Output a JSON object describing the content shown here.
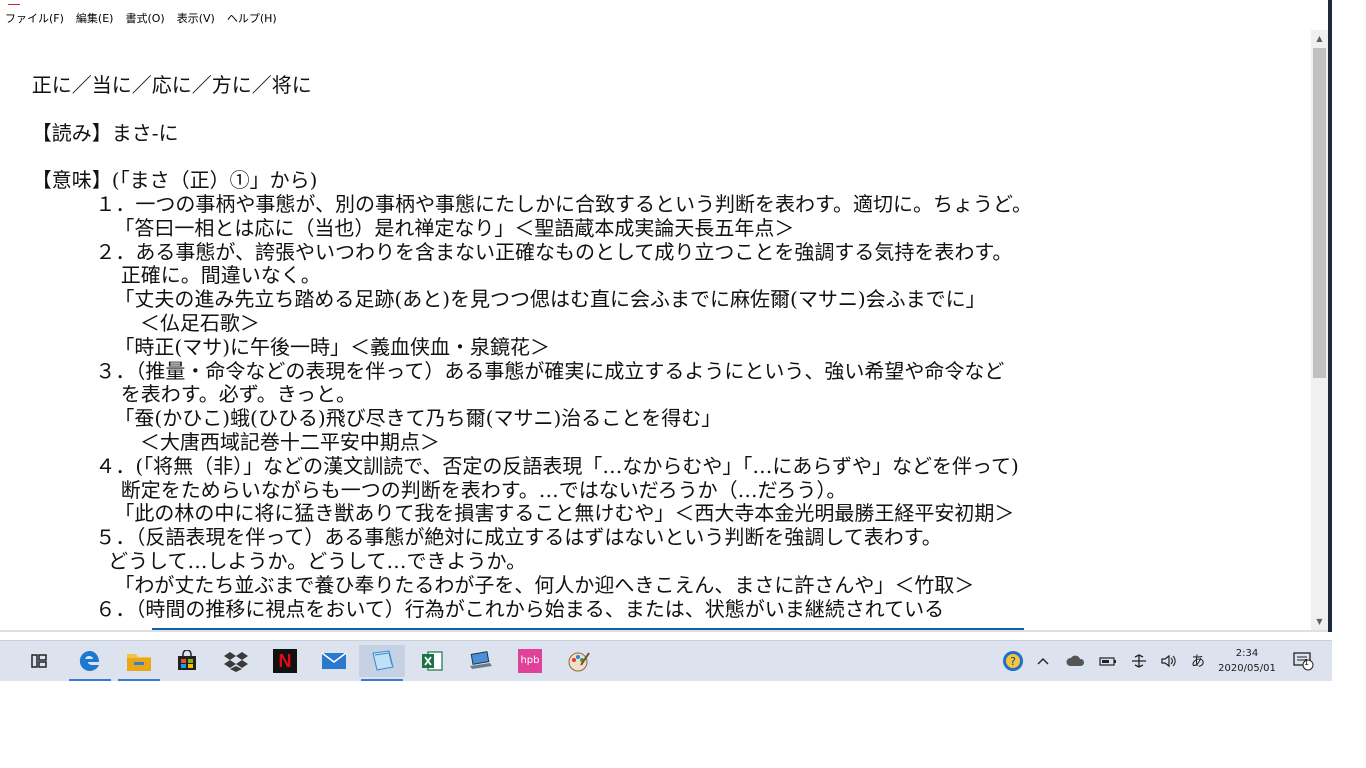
{
  "window": {
    "menu": [
      "ファイル(F)",
      "編集(E)",
      "書式(O)",
      "表示(V)",
      "ヘルプ(H)"
    ]
  },
  "document": {
    "lines": [
      "     正に／当に／応に／方に／将に",
      "",
      "     【読み】まさ‐に",
      "",
      "     【意味】(「まさ（正）①」から)",
      "               １．一つの事柄や事態が、別の事柄や事態にたしかに合致するという判断を表わす。適切に。ちょうど。",
      "                  「答曰一相とは応に（当也）是れ禅定なり」＜聖語蔵本成実論天長五年点＞",
      "               ２．ある事態が、誇張やいつわりを含まない正確なものとして成り立つことを強調する気持を表わす。",
      "                   正確に。間違いなく。",
      "                  「丈夫の進み先立ち踏める足跡(あと)を見つつ偲はむ直に会ふまでに麻佐爾(マサニ)会ふまでに」",
      "                      ＜仏足石歌＞",
      "                  「時正(マサ)に午後一時」＜義血侠血・泉鏡花＞",
      "               ３．（推量・命令などの表現を伴って）ある事態が確実に成立するようにという、強い希望や命令など",
      "                   を表わす。必ず。きっと。",
      "                  「蚕(かひこ)蛾(ひひる)飛び尽きて乃ち爾(マサニ)治ることを得む」",
      "                      ＜大唐西域記巻十二平安中期点＞",
      "               ４．(「将無（非）」などの漢文訓読で、否定の反語表現「…なからむや」「…にあらずや」などを伴って)",
      "                   断定をためらいながらも一つの判断を表わす。…ではないだろうか（…だろう）。",
      "                  「此の林の中に将に猛き獣ありて我を損害すること無けむや」＜西大寺本金光明最勝王経平安初期＞",
      "               ５．（反語表現を伴って）ある事態が絶対に成立するはずはないという判断を強調して表わす。",
      "                 どうして…しようか。どうして…できようか。",
      "                  「わが丈たち並ぶまで養ひ奉りたるわが子を、何人か迎へきこえん、まさに許さんや」＜竹取＞",
      "               ６．（時間の推移に視点をおいて）行為がこれから始まる、または、状態がいま継続されている"
    ]
  },
  "scrollbar": {
    "up_icon": "scroll-up-arrow",
    "down_icon": "scroll-down-arrow"
  },
  "taskbar": {
    "apps": [
      "task-view-icon",
      "edge-icon",
      "file-explorer-icon",
      "store-icon",
      "dropbox-icon",
      "netflix-icon",
      "mail-icon",
      "notepad-icon",
      "excel-icon",
      "device-icon",
      "hpb-icon",
      "paint-icon"
    ],
    "hpb_label": "hpb",
    "netflix_label": "N",
    "ime_label": "あ",
    "clock_time": "2:34",
    "clock_date": "2020/05/01",
    "notification_count": "1",
    "colors": {
      "edge": "#1e78d2",
      "netflix_bg": "#111111",
      "netflix_fg": "#e50914",
      "hpb": "#e0429a",
      "excel": "#1e7145",
      "dropbox": "#3a3a3a",
      "accent": "#0f5fb2"
    }
  }
}
